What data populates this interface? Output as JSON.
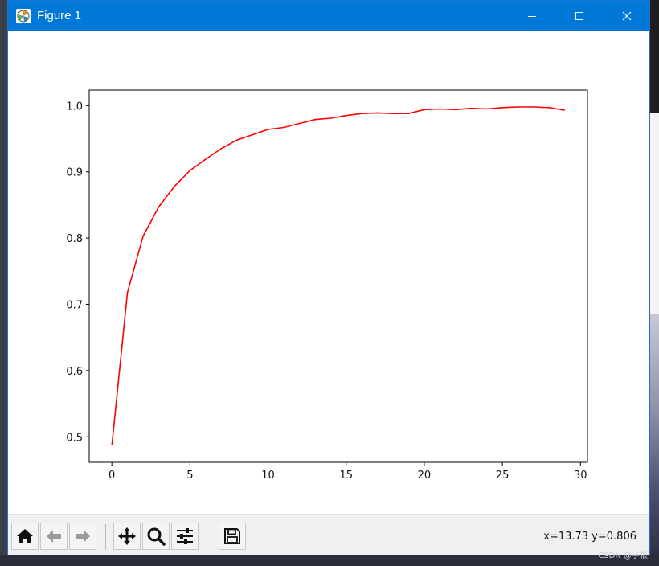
{
  "window": {
    "title": "Figure 1",
    "icon": "matplotlib-icon",
    "controls": [
      "minimize-icon",
      "maximize-icon",
      "close-icon"
    ]
  },
  "toolbar": {
    "tools": [
      "home-icon",
      "back-arrow-icon",
      "forward-arrow-icon",
      "pan-icon",
      "zoom-icon",
      "configure-subplots-icon",
      "save-icon"
    ],
    "coordinates": "x=13.73 y=0.806"
  },
  "watermark": "CSDN @子根",
  "chart_data": {
    "type": "line",
    "x": [
      0,
      1,
      2,
      3,
      4,
      5,
      6,
      7,
      8,
      9,
      10,
      11,
      12,
      13,
      14,
      15,
      16,
      17,
      18,
      19,
      20,
      21,
      22,
      23,
      24,
      25,
      26,
      27,
      28,
      29
    ],
    "series": [
      {
        "color": "#ff0000",
        "values": [
          0.487,
          0.718,
          0.803,
          0.847,
          0.878,
          0.902,
          0.919,
          0.935,
          0.948,
          0.956,
          0.964,
          0.967,
          0.973,
          0.979,
          0.981,
          0.985,
          0.988,
          0.989,
          0.988,
          0.988,
          0.994,
          0.995,
          0.994,
          0.996,
          0.995,
          0.997,
          0.998,
          0.998,
          0.997,
          0.993
        ]
      }
    ],
    "xlim": [
      -1.45,
      30.45
    ],
    "ylim": [
      0.4615,
      1.0235
    ],
    "xticks": [
      0,
      5,
      10,
      15,
      20,
      25,
      30
    ],
    "yticks": [
      0.5,
      0.6,
      0.7,
      0.8,
      0.9,
      1.0
    ],
    "xtick_labels": [
      "0",
      "5",
      "10",
      "15",
      "20",
      "25",
      "30"
    ],
    "ytick_labels": [
      "0.5",
      "0.6",
      "0.7",
      "0.8",
      "0.9",
      "1.0"
    ],
    "title": "",
    "xlabel": "",
    "ylabel": "",
    "grid": false,
    "legend": false
  }
}
